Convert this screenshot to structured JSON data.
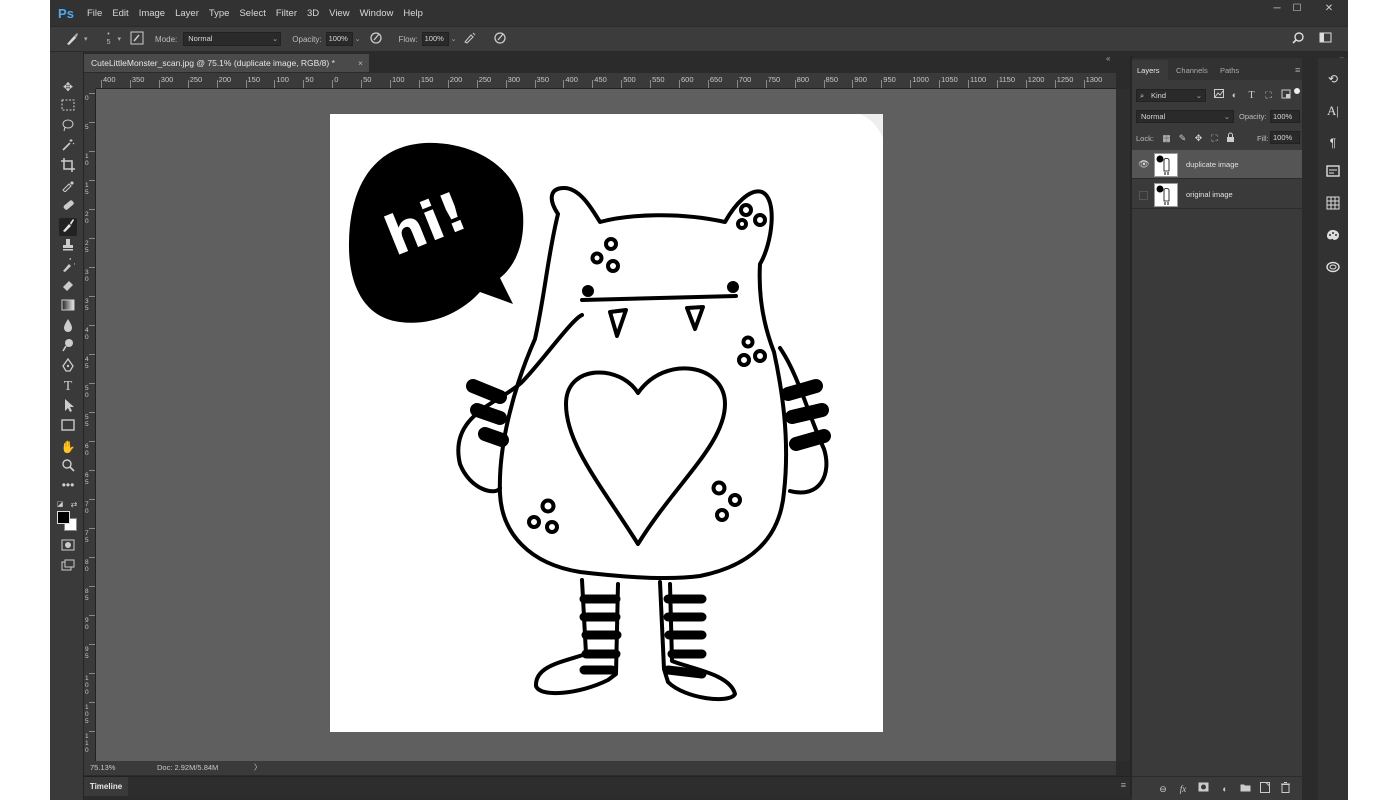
{
  "app": {
    "logo": "Ps"
  },
  "menu": [
    "File",
    "Edit",
    "Image",
    "Layer",
    "Type",
    "Select",
    "Filter",
    "3D",
    "View",
    "Window",
    "Help"
  ],
  "window_controls": {
    "minimize": "─",
    "maximize": "☐",
    "close": "✕"
  },
  "options_bar": {
    "brush_size": "5",
    "mode_label": "Mode:",
    "mode_value": "Normal",
    "opacity_label": "Opacity:",
    "opacity_value": "100%",
    "flow_label": "Flow:",
    "flow_value": "100%"
  },
  "document_tab": {
    "title": "CuteLittleMonster_scan.jpg @ 75.1% (duplicate image, RGB/8) *",
    "close": "×"
  },
  "ruler": {
    "h_labels": [
      "400",
      "350",
      "300",
      "250",
      "200",
      "150",
      "100",
      "50",
      "0",
      "50",
      "100",
      "150",
      "200",
      "250",
      "300",
      "350",
      "400",
      "450",
      "500",
      "550",
      "600",
      "650",
      "700",
      "750",
      "800",
      "850",
      "900",
      "950",
      "1000",
      "1050",
      "1100",
      "1150",
      "1200",
      "1250",
      "1300"
    ],
    "v_labels": [
      "0",
      "5",
      "1 0",
      "1 5",
      "2 0",
      "2 5",
      "3 0",
      "3 5",
      "4 0",
      "4 5",
      "5 0",
      "5 5",
      "6 0",
      "6 5",
      "7 0",
      "7 5",
      "8 0",
      "8 5",
      "9 0",
      "9 5",
      "1 0 0",
      "1 0 5",
      "1 1 0"
    ]
  },
  "artwork": {
    "speech_text": "hi!"
  },
  "status_bar": {
    "zoom": "75.13%",
    "doc_info": "Doc: 2.92M/5.84M",
    "arrow": "〉"
  },
  "timeline": {
    "label": "Timeline"
  },
  "layers_panel": {
    "tabs": [
      "Layers",
      "Channels",
      "Paths"
    ],
    "filter_kind": "Kind",
    "blend_mode": "Normal",
    "opacity_label": "Opacity:",
    "opacity_value": "100%",
    "lock_label": "Lock:",
    "fill_label": "Fill:",
    "fill_value": "100%",
    "layers": [
      {
        "name": "duplicate image",
        "visible": true,
        "selected": true
      },
      {
        "name": "original image",
        "visible": false,
        "selected": false
      }
    ]
  },
  "colors": {
    "app_bg": "#2b2b2b",
    "canvas_bg": "#5f5f5f",
    "ps_blue": "#4ea9f0",
    "selected_layer": "#555555"
  }
}
